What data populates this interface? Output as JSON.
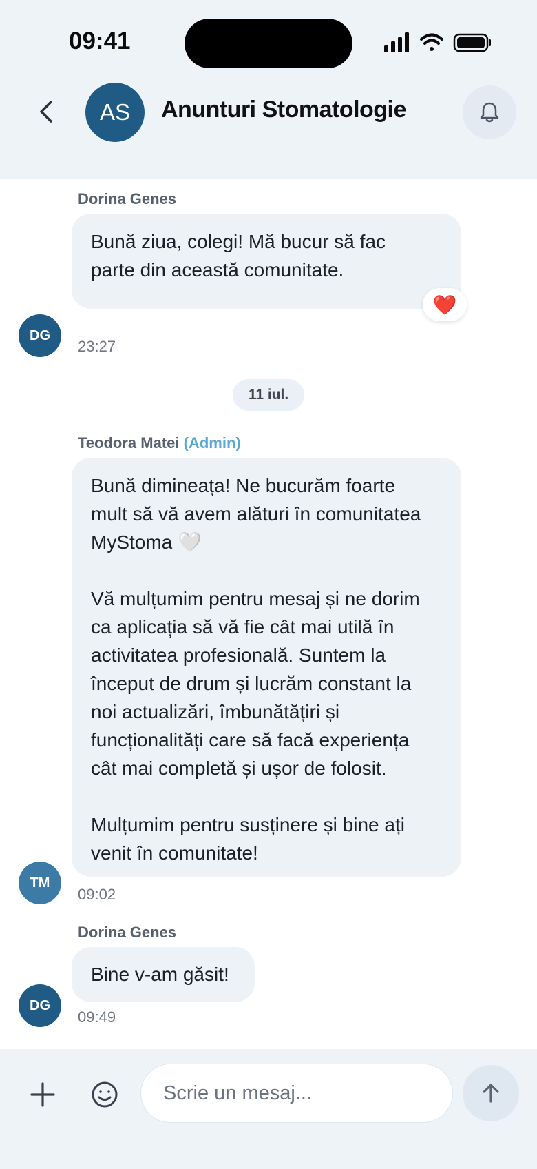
{
  "status_bar": {
    "time": "09:41"
  },
  "header": {
    "avatar_initials": "AS",
    "title": "Anunturi Stomatologie"
  },
  "messages": [
    {
      "sender": "Dorina Genes",
      "initials": "DG",
      "lines": [
        "Bună ziua, colegi! Mă bucur să fac",
        "parte din această comunitate."
      ],
      "reaction": "❤️",
      "time": "23:27"
    },
    {
      "sender": "Teodora Matei",
      "role": "(Admin)",
      "initials": "TM",
      "lines": [
        "Bună dimineața! Ne bucurăm foarte",
        "mult să vă avem alături în comunitatea",
        "MyStoma 🤍",
        "",
        "Vă mulțumim pentru mesaj și ne dorim",
        "ca aplicația să vă fie cât mai utilă în",
        "activitatea profesională. Suntem la",
        "început de drum și lucrăm constant la",
        "noi actualizări, îmbunătățiri și",
        "funcționalități care să facă experiența",
        "cât mai completă și ușor de folosit.",
        "",
        "Mulțumim pentru susținere și bine ați",
        "venit în comunitate!"
      ],
      "time": "09:02"
    },
    {
      "sender": "Dorina Genes",
      "initials": "DG",
      "lines": [
        "Bine v-am găsit!"
      ],
      "time": "09:49"
    }
  ],
  "date_separator": "11 iul.",
  "composer": {
    "placeholder": "Scrie un mesaj..."
  },
  "icons": {
    "back": "chevron-left-icon",
    "bell": "bell-icon",
    "plus": "plus-icon",
    "emoji": "smiley-icon",
    "send": "arrow-up-icon"
  },
  "colors": {
    "avatar_dark": "#1f5b84",
    "avatar_mid": "#3c7ba6",
    "admin_label": "#5aa7d4",
    "bubble": "#edf2f7"
  }
}
